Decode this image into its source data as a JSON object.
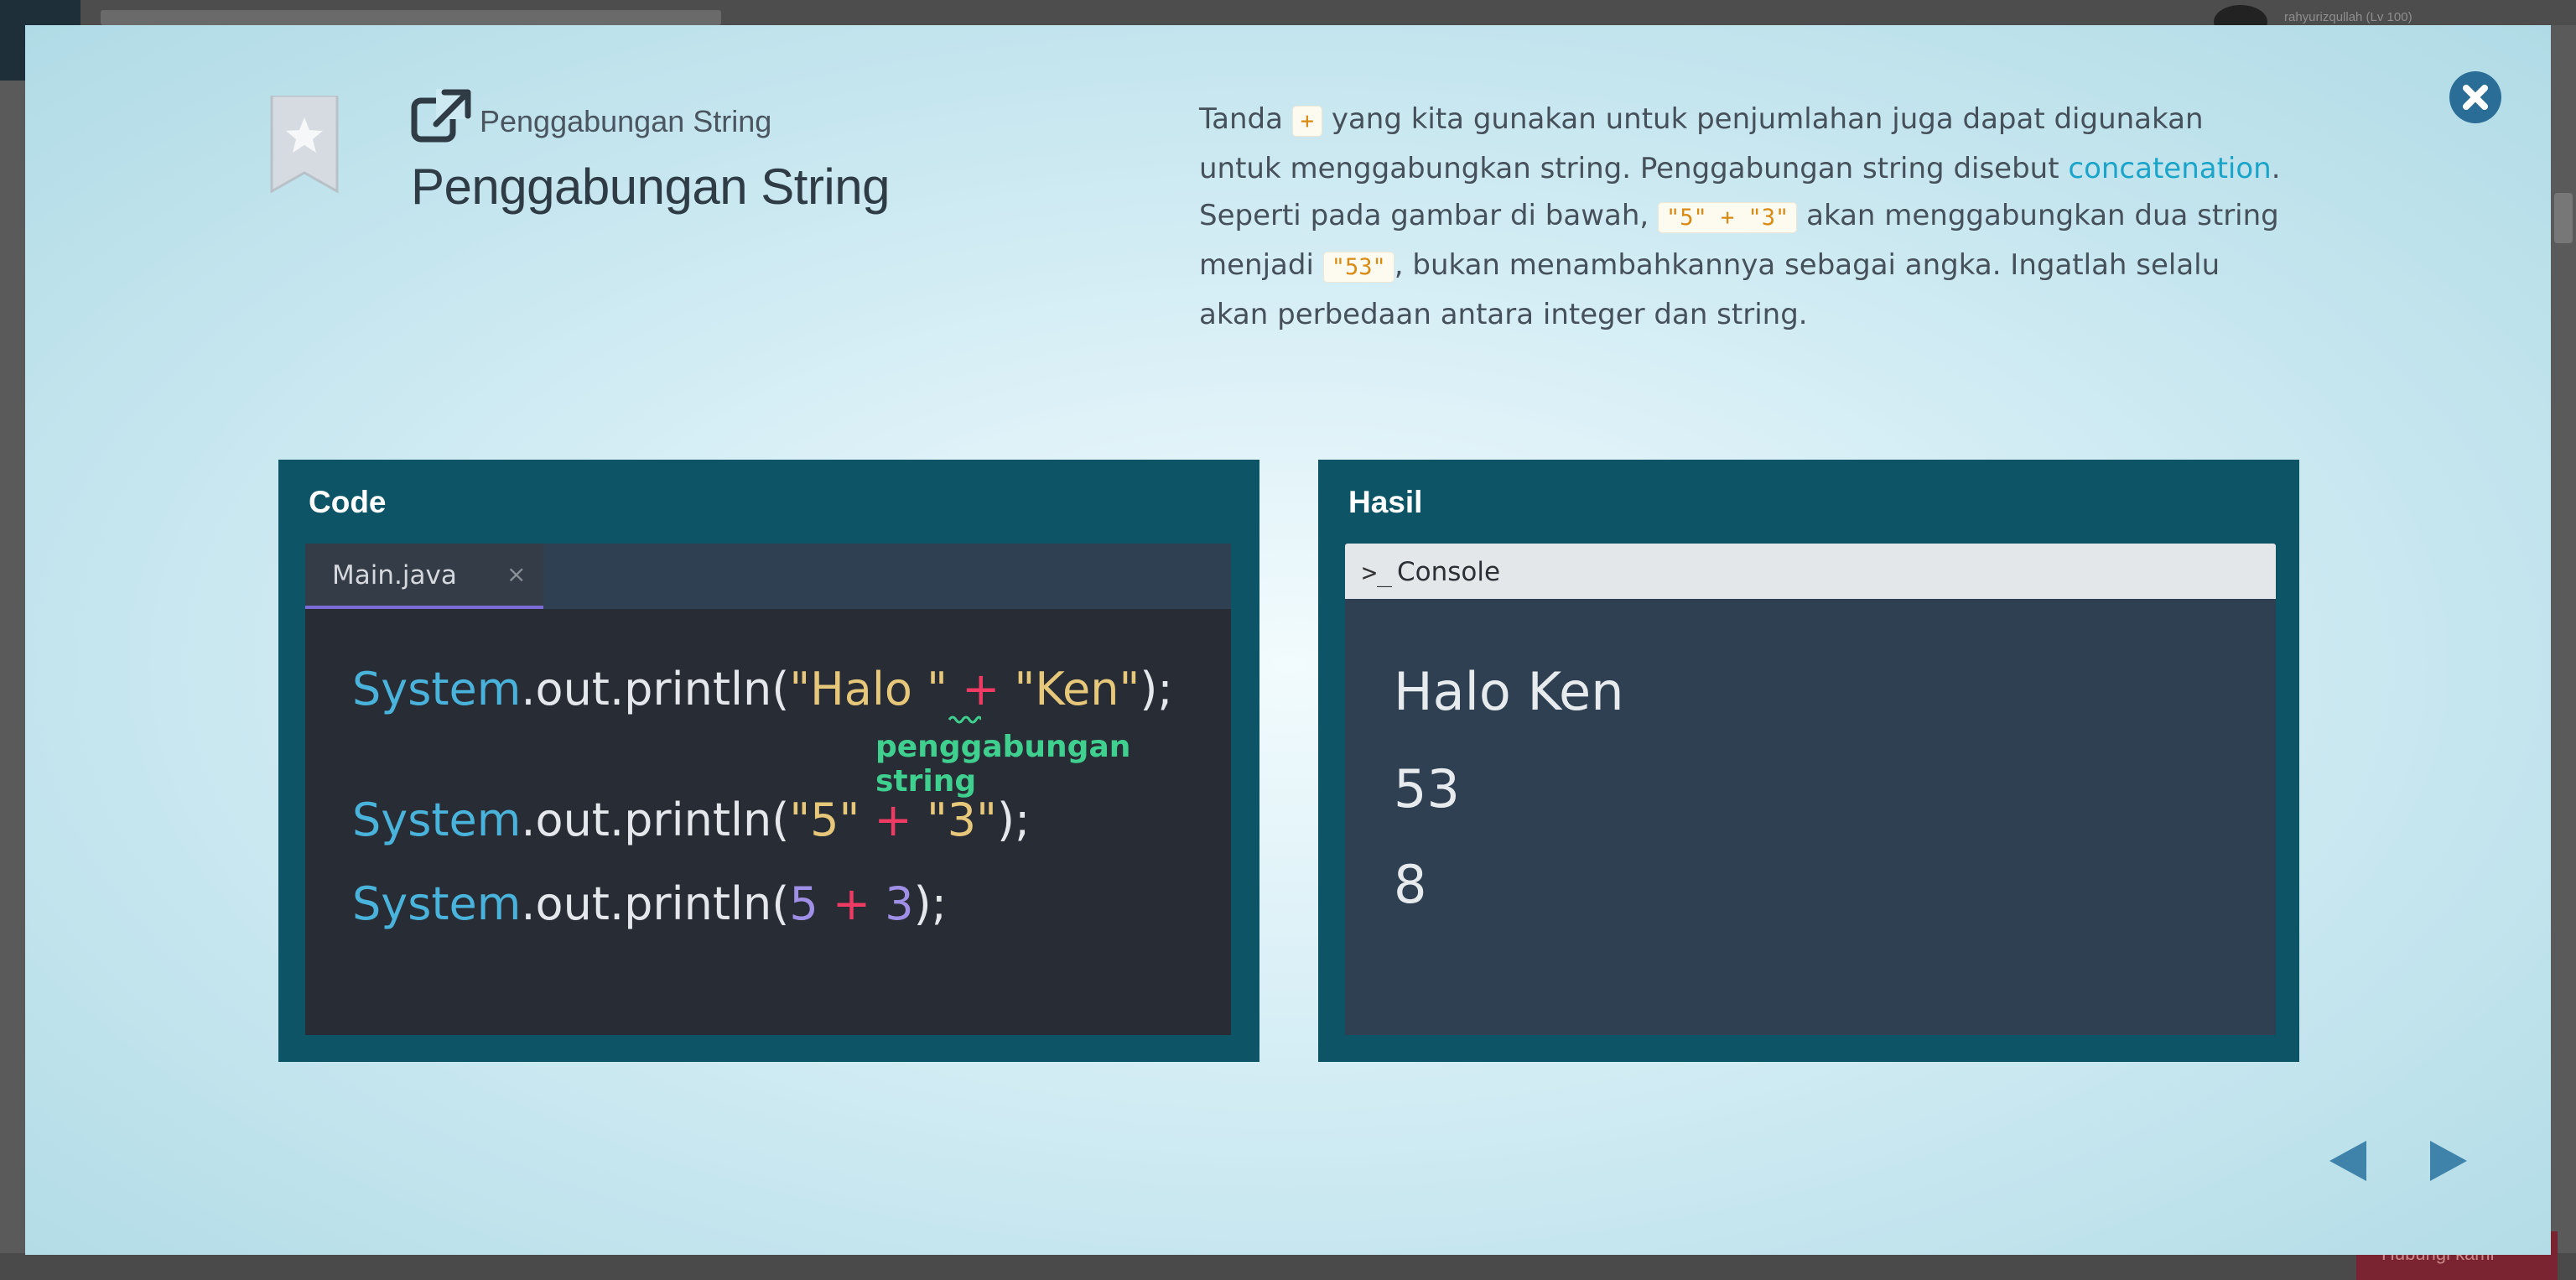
{
  "background": {
    "user_label": "rahyurizqullah (Lv 100)",
    "help_label": "Hubungi kami"
  },
  "lesson": {
    "subtitle": "Penggabungan String",
    "title": "Penggabungan String",
    "description": {
      "p1": "Tanda ",
      "code_plus": "+",
      "p2": " yang kita gunakan untuk penjumlahan juga dapat digunakan untuk menggabungkan string. Penggabungan string disebut ",
      "term": "concatenation",
      "p3": ". Seperti pada gambar di bawah, ",
      "code_expr": "\"5\" + \"3\"",
      "p4": " akan menggabungkan dua string menjadi ",
      "code_result": "\"53\"",
      "p5": ", bukan menambahkannya sebagai angka. Ingatlah selalu akan perbedaan antara integer dan string."
    }
  },
  "code_panel": {
    "label": "Code",
    "tab_name": "Main.java",
    "tab_close": "×",
    "line1": {
      "sys": "System",
      "call": ".out.println(",
      "s1": "\"Halo \"",
      "op": " + ",
      "s2": "\"Ken\"",
      "end": ");"
    },
    "annotation": "penggabungan string",
    "line2": {
      "sys": "System",
      "call": ".out.println(",
      "s1": "\"5\"",
      "op": " + ",
      "s2": "\"3\"",
      "end": ");"
    },
    "line3": {
      "sys": "System",
      "call": ".out.println(",
      "n1": "5",
      "op": " + ",
      "n2": "3",
      "end": ");"
    }
  },
  "result_panel": {
    "label": "Hasil",
    "console_title": "Console",
    "console_icon": ">_",
    "output": [
      "Halo Ken",
      "53",
      "8"
    ]
  },
  "icons": {
    "bookmark": "bookmark-star-icon",
    "external": "external-link-icon",
    "close": "close-circle-icon",
    "prev": "triangle-left-icon",
    "next": "triangle-right-icon"
  },
  "colors": {
    "accent": "#1ba4c9",
    "panel": "#0d5566",
    "code_bg": "#282c34",
    "string": "#e7c87a",
    "operator": "#ef3b64",
    "keyword_system": "#4ab3db",
    "number": "#a08fe6",
    "annotation": "#3fd08f"
  }
}
